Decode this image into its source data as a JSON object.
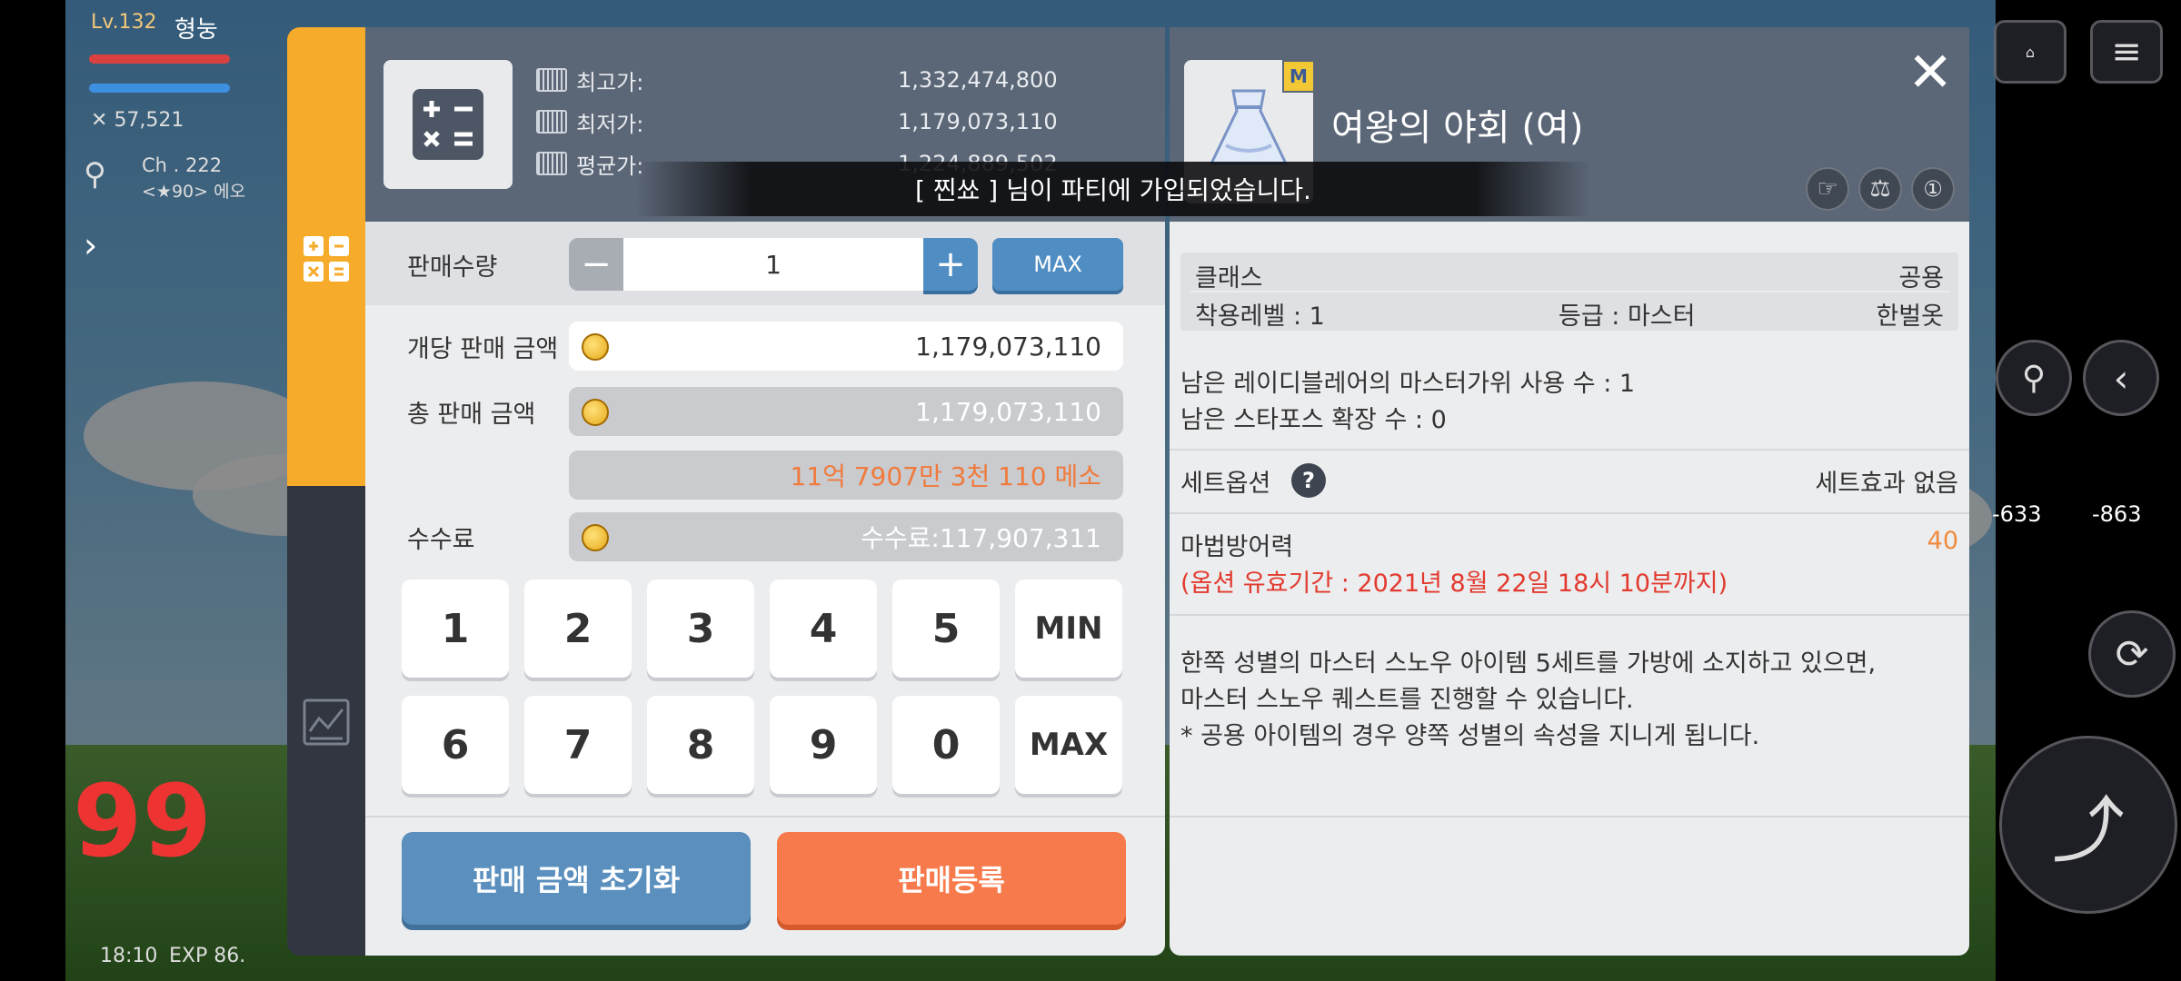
{
  "hud": {
    "level": "Lv.132",
    "name": "형눙",
    "combat_power": "57,521",
    "channel": "Ch . 222",
    "channel_sub": "<★90> 에오",
    "time": "18:10",
    "exp": "EXP 86.",
    "damage1": "-633",
    "damage2": "-863",
    "big_number": "99"
  },
  "calc": {
    "prices": [
      {
        "label": "최고가:",
        "value": "1,332,474,800"
      },
      {
        "label": "최저가:",
        "value": "1,179,073,110"
      },
      {
        "label": "평균가:",
        "value": "1,224,889,502"
      }
    ],
    "quantity_label": "판매수량",
    "quantity_value": "1",
    "minus": "−",
    "plus": "+",
    "max_label": "MAX",
    "unit_price_label": "개당 판매 금액",
    "unit_price_value": "1,179,073,110",
    "total_label": "총 판매 금액",
    "total_value": "1,179,073,110",
    "total_korean": "11억 7907만 3천 110 메소",
    "fee_label": "수수료",
    "fee_value": "수수료:117,907,311",
    "keys_row1": [
      "1",
      "2",
      "3",
      "4",
      "5",
      "MIN"
    ],
    "keys_row2": [
      "6",
      "7",
      "8",
      "9",
      "0",
      "MAX"
    ],
    "reset_button": "판매 금액 초기화",
    "register_button": "판매등록"
  },
  "notice": "[ 찐쑈 ] 님이 파티에 가입되었습니다.",
  "item": {
    "badge": "M",
    "name": "여왕의 야회 (여)",
    "class_label": "클래스",
    "class_value": "공용",
    "req_level": "착용레벨 :  1",
    "grade": "등급 :  마스터",
    "type": "한벌옷",
    "scissors_text": "남은 레이디블레어의 마스터가위 사용 수 :  1",
    "starforce_text": "남은 스타포스 확장 수 : 0",
    "set_label": "세트옵션",
    "set_value": "세트효과 없음",
    "mdef_label": "마법방어력",
    "mdef_value": "40",
    "expiry": "(옵션 유효기간 : 2021년 8월 22일 18시 10분까지)",
    "desc1": "한쪽 성별의 마스터 스노우 아이템 5세트를 가방에 소지하고 있으면,",
    "desc2": "마스터 스노우 퀘스트를 진행할 수 있습니다.",
    "desc3": "* 공용 아이템의 경우 양쪽 성별의 속성을 지니게 됩니다."
  },
  "colors": {
    "accent_orange": "#f6ab2a",
    "header_slate": "#5b6676",
    "reset_blue": "#5a8fbe",
    "register_orange": "#f77a4c",
    "red_text": "#e23a2e",
    "orange_text": "#f08a3c"
  }
}
